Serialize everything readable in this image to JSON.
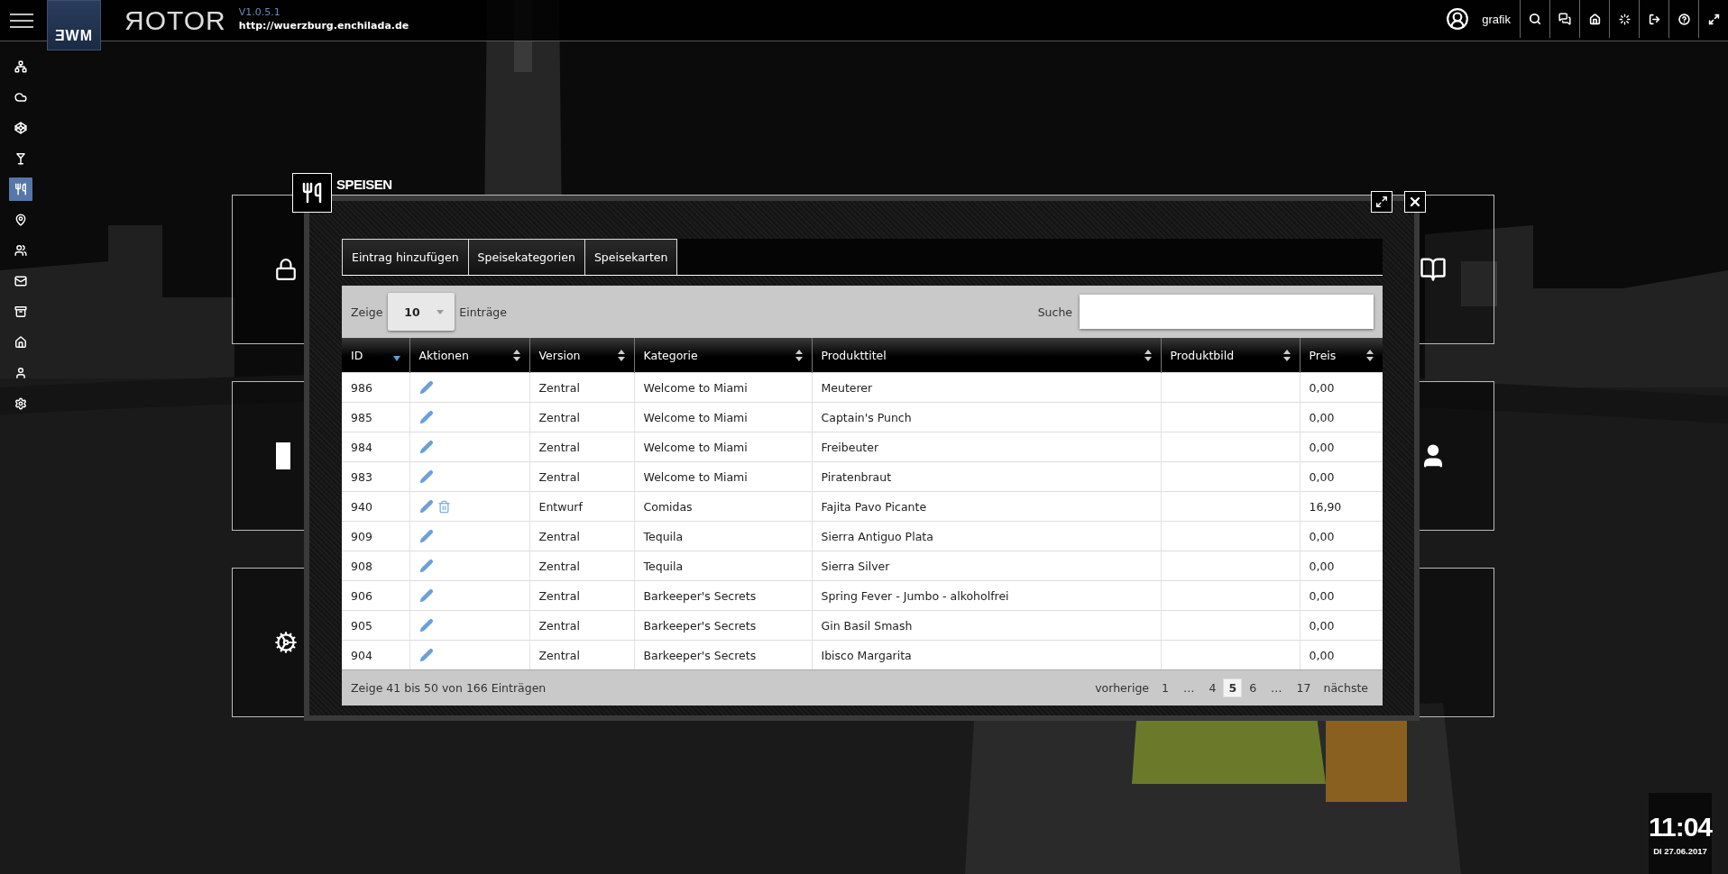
{
  "header": {
    "logo": "ƎWM",
    "app_name": "ЯOTOR",
    "version": "V1.0.5.1",
    "url": "http://wuerzburg.enchilada.de",
    "user": "grafik"
  },
  "sidebar": {
    "items": [
      {
        "selected": false
      },
      {
        "selected": false
      },
      {
        "selected": false
      },
      {
        "selected": false
      },
      {
        "selected": true
      },
      {
        "selected": false
      },
      {
        "selected": false
      },
      {
        "selected": false
      },
      {
        "selected": false
      },
      {
        "selected": false
      },
      {
        "selected": false
      },
      {
        "selected": false
      }
    ]
  },
  "dialog": {
    "title": "SPEISEN",
    "tabs": [
      "Eintrag hinzufügen",
      "Speisekategorien",
      "Speisekarten"
    ],
    "length": {
      "label_before": "Zeige",
      "value": "10",
      "label_after": "Einträge"
    },
    "search": {
      "label": "Suche"
    },
    "table": {
      "columns": [
        {
          "label": "ID",
          "sorted": true
        },
        {
          "label": "Aktionen",
          "sorted": false
        },
        {
          "label": "Version",
          "sorted": false
        },
        {
          "label": "Kategorie",
          "sorted": false
        },
        {
          "label": "Produkttitel",
          "sorted": false
        },
        {
          "label": "Produktbild",
          "sorted": false
        },
        {
          "label": "Preis",
          "sorted": false
        }
      ],
      "rows": [
        {
          "id": "986",
          "deletable": false,
          "version": "Zentral",
          "category": "Welcome to Miami",
          "title": "Meuterer",
          "price": "0,00"
        },
        {
          "id": "985",
          "deletable": false,
          "version": "Zentral",
          "category": "Welcome to Miami",
          "title": "Captain's Punch",
          "price": "0,00"
        },
        {
          "id": "984",
          "deletable": false,
          "version": "Zentral",
          "category": "Welcome to Miami",
          "title": "Freibeuter",
          "price": "0,00"
        },
        {
          "id": "983",
          "deletable": false,
          "version": "Zentral",
          "category": "Welcome to Miami",
          "title": "Piratenbraut",
          "price": "0,00"
        },
        {
          "id": "940",
          "deletable": true,
          "version": "Entwurf",
          "category": "Comidas",
          "title": "Fajita Pavo Picante",
          "price": "16,90"
        },
        {
          "id": "909",
          "deletable": false,
          "version": "Zentral",
          "category": "Tequila",
          "title": "Sierra Antiguo Plata",
          "price": "0,00"
        },
        {
          "id": "908",
          "deletable": false,
          "version": "Zentral",
          "category": "Tequila",
          "title": "Sierra Silver",
          "price": "0,00"
        },
        {
          "id": "906",
          "deletable": false,
          "version": "Zentral",
          "category": "Barkeeper's Secrets",
          "title": "Spring Fever - Jumbo - alkoholfrei",
          "price": "0,00"
        },
        {
          "id": "905",
          "deletable": false,
          "version": "Zentral",
          "category": "Barkeeper's Secrets",
          "title": "Gin Basil Smash",
          "price": "0,00"
        },
        {
          "id": "904",
          "deletable": false,
          "version": "Zentral",
          "category": "Barkeeper's Secrets",
          "title": "Ibisco Margarita",
          "price": "0,00"
        }
      ]
    },
    "info": "Zeige 41 bis 50 von 166 Einträgen",
    "pagination": [
      {
        "label": "vorherige",
        "kind": "nav",
        "selected": false
      },
      {
        "label": "1",
        "kind": "page",
        "selected": false
      },
      {
        "label": "…",
        "kind": "ellipsis",
        "selected": false
      },
      {
        "label": "4",
        "kind": "page",
        "selected": false
      },
      {
        "label": "5",
        "kind": "page",
        "selected": true
      },
      {
        "label": "6",
        "kind": "page",
        "selected": false
      },
      {
        "label": "…",
        "kind": "ellipsis",
        "selected": false
      },
      {
        "label": "17",
        "kind": "page",
        "selected": false
      },
      {
        "label": "nächste",
        "kind": "nav",
        "selected": false
      }
    ]
  },
  "clock": {
    "time": "11:04",
    "date": "DI 27.06.2017"
  }
}
